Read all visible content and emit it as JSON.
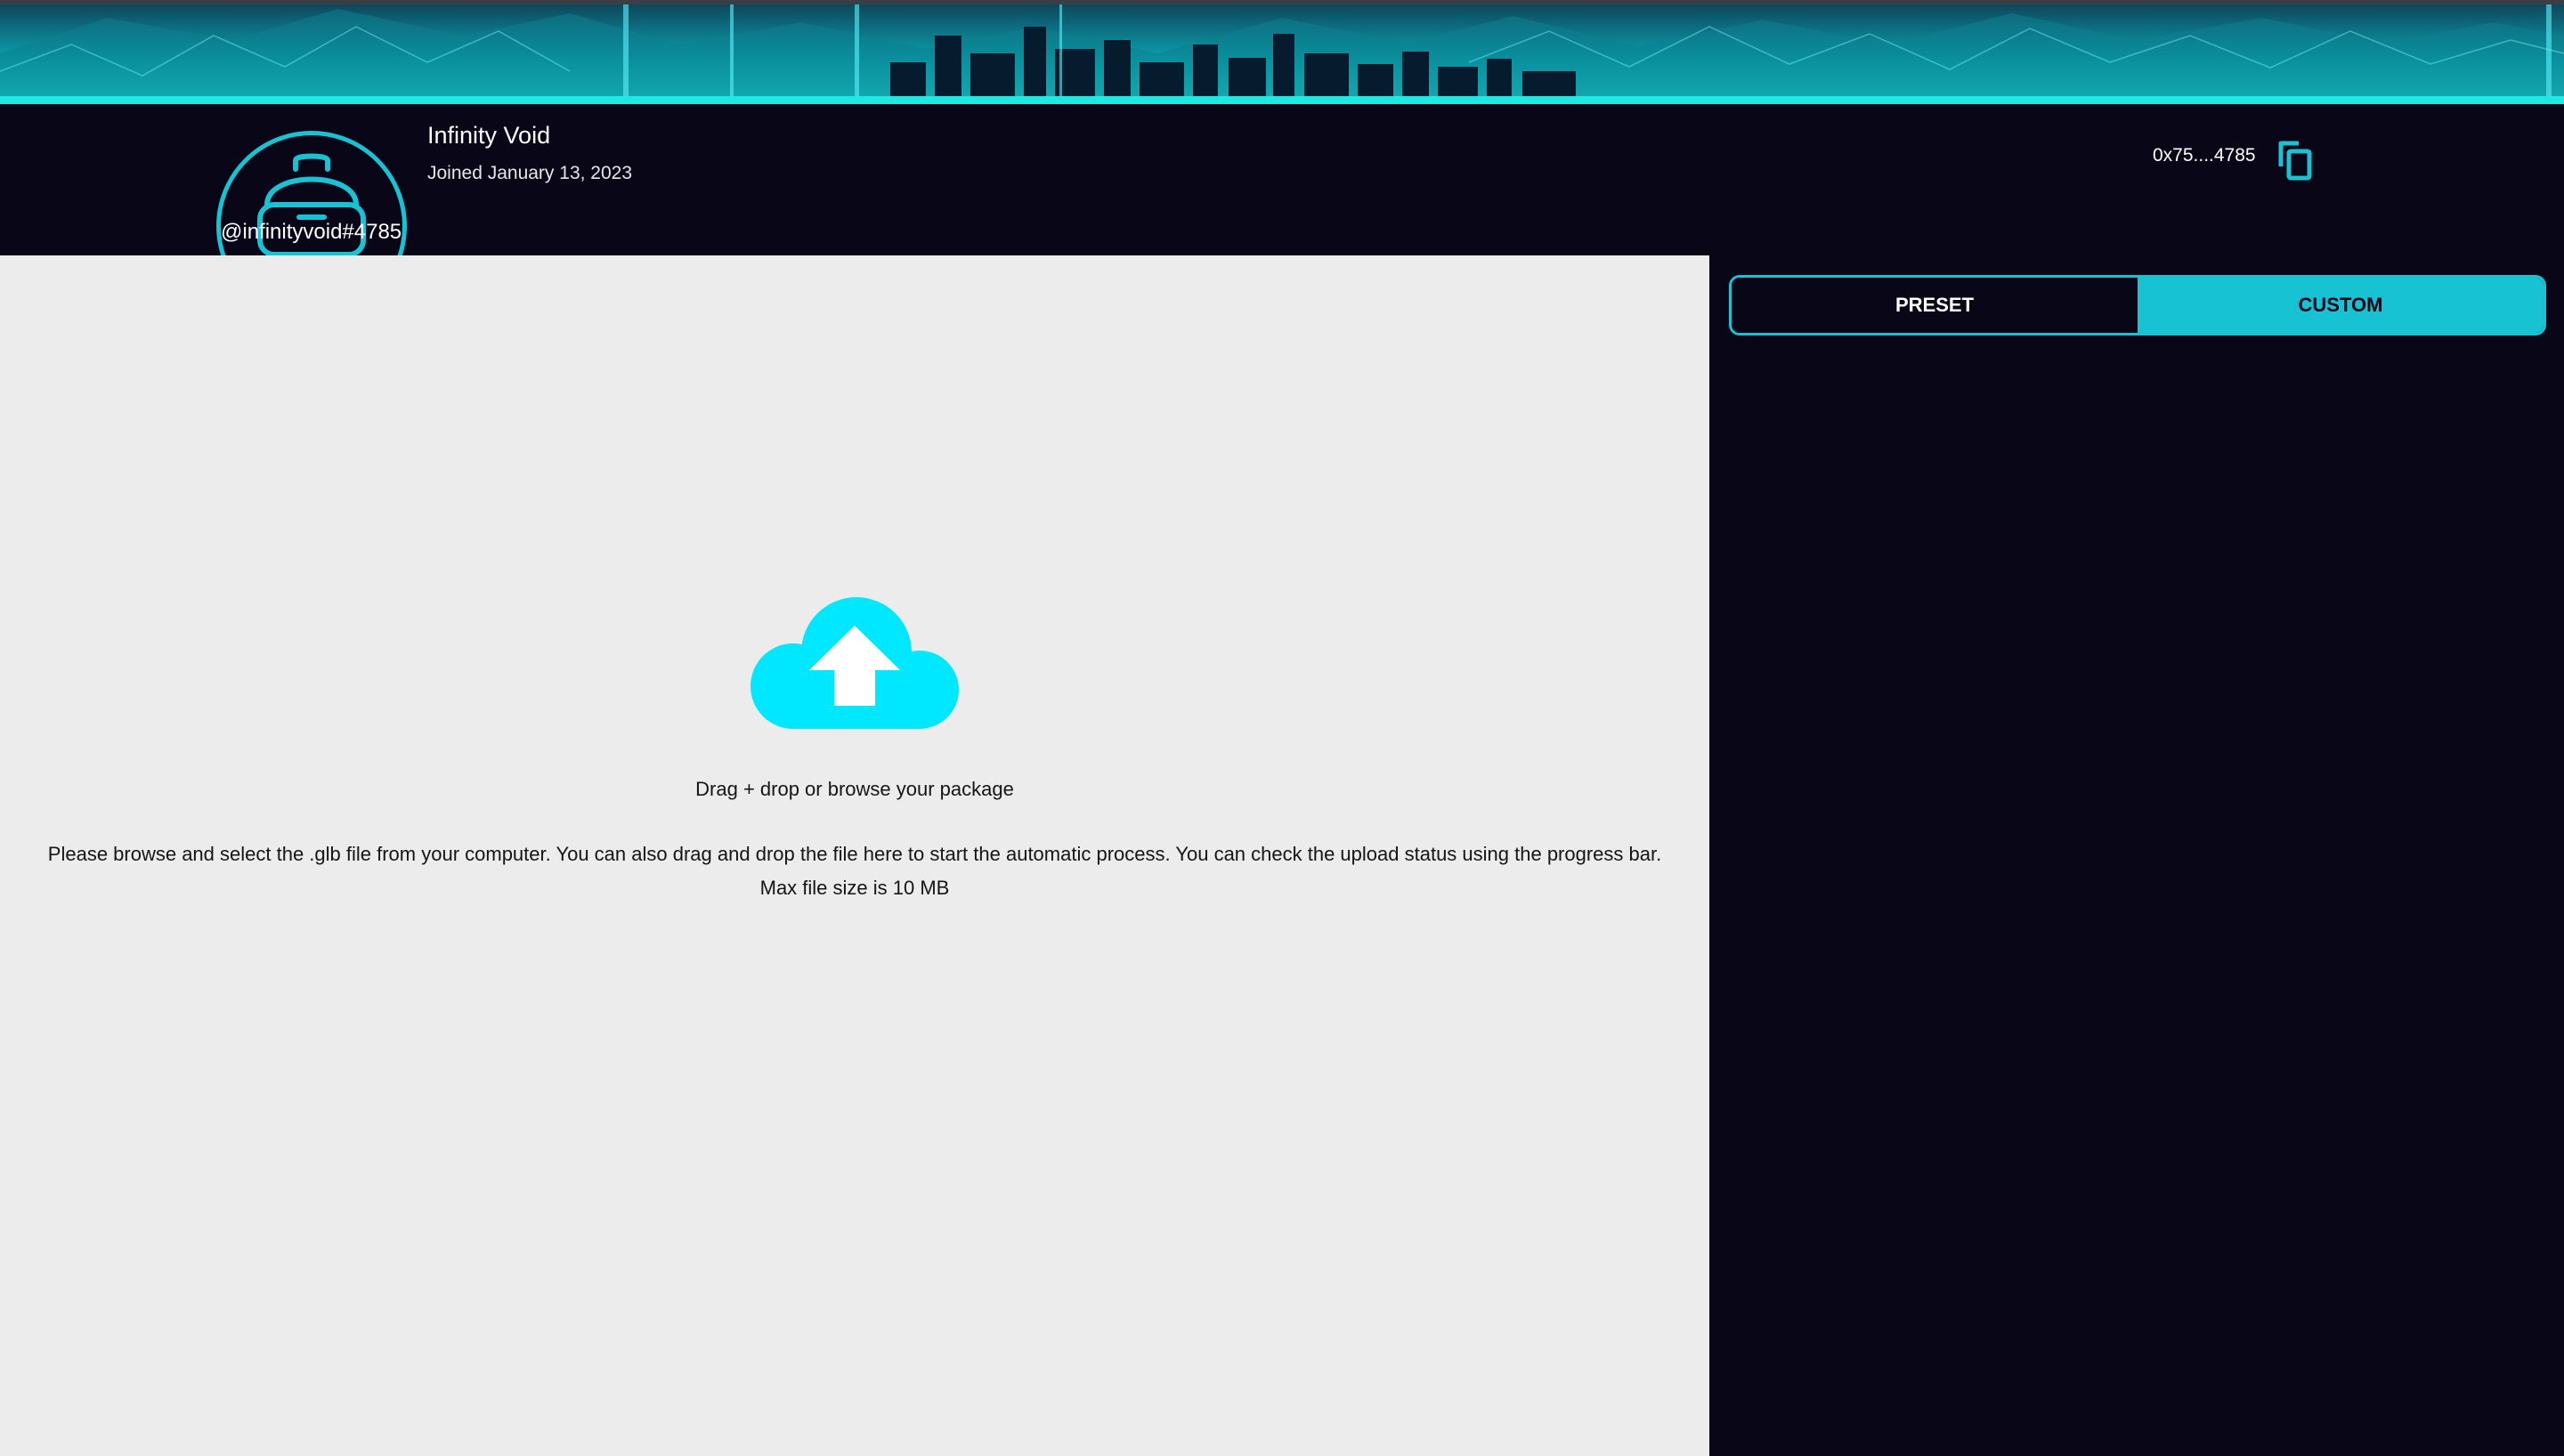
{
  "profile": {
    "name": "Infinity Void",
    "joined": "Joined January 13, 2023",
    "handle": "@infinityvoid#4785",
    "wallet_short": "0x75....4785",
    "avatar_icon": "vr-headset-person-icon",
    "copy_icon": "copy-icon"
  },
  "upload": {
    "icon": "cloud-upload-icon",
    "title": "Drag + drop or browse your package",
    "description": "Please browse and select the .glb file from your computer. You can also drag and drop the file here to start the automatic process. You can check the upload status using the progress bar.",
    "max_size": "Max file size is 10 MB"
  },
  "tabs": {
    "items": [
      {
        "label": "PRESET",
        "active": false
      },
      {
        "label": "CUSTOM",
        "active": true
      }
    ]
  },
  "colors": {
    "accent": "#17c2d3",
    "background": "#080617",
    "dropzone": "#ececec",
    "upload_icon": "#00e8ff"
  }
}
